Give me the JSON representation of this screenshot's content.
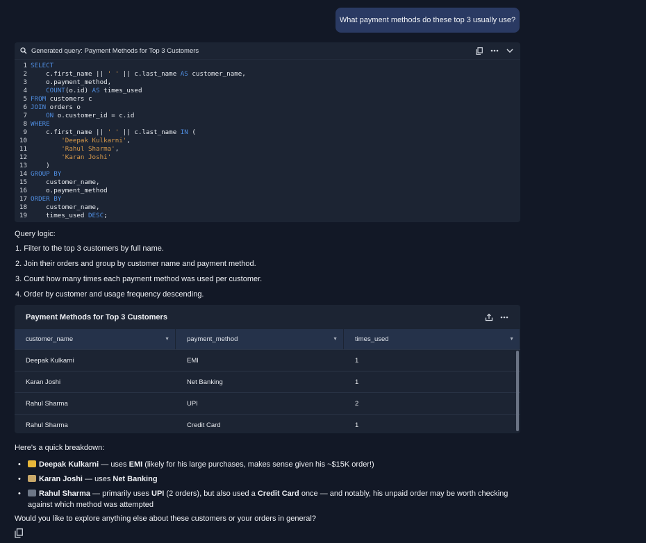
{
  "user_message": "What payment methods do these top 3 usually use?",
  "code_block": {
    "title": "Generated query: Payment Methods for Top 3 Customers",
    "lines": [
      {
        "n": "1",
        "segs": [
          [
            "kw",
            "SELECT"
          ]
        ]
      },
      {
        "n": "2",
        "segs": [
          [
            "t",
            "    c.first_name || "
          ],
          [
            "str",
            "' '"
          ],
          [
            "t",
            " || c.last_name "
          ],
          [
            "kw",
            "AS"
          ],
          [
            "t",
            " customer_name,"
          ]
        ]
      },
      {
        "n": "3",
        "segs": [
          [
            "t",
            "    o.payment_method,"
          ]
        ]
      },
      {
        "n": "4",
        "segs": [
          [
            "t",
            "    "
          ],
          [
            "kw",
            "COUNT"
          ],
          [
            "t",
            "(o.id) "
          ],
          [
            "kw",
            "AS"
          ],
          [
            "t",
            " times_used"
          ]
        ]
      },
      {
        "n": "5",
        "segs": [
          [
            "kw",
            "FROM"
          ],
          [
            "t",
            " customers c"
          ]
        ]
      },
      {
        "n": "6",
        "segs": [
          [
            "kw",
            "JOIN"
          ],
          [
            "t",
            " orders o"
          ]
        ]
      },
      {
        "n": "7",
        "segs": [
          [
            "t",
            "    "
          ],
          [
            "kw",
            "ON"
          ],
          [
            "t",
            " o.customer_id = c.id"
          ]
        ]
      },
      {
        "n": "8",
        "segs": [
          [
            "kw",
            "WHERE"
          ]
        ]
      },
      {
        "n": "9",
        "segs": [
          [
            "t",
            "    c.first_name || "
          ],
          [
            "str",
            "' '"
          ],
          [
            "t",
            " || c.last_name "
          ],
          [
            "kw",
            "IN"
          ],
          [
            "t",
            " ("
          ]
        ]
      },
      {
        "n": "10",
        "segs": [
          [
            "t",
            "        "
          ],
          [
            "str",
            "'Deepak Kulkarni'"
          ],
          [
            "t",
            ","
          ]
        ]
      },
      {
        "n": "11",
        "segs": [
          [
            "t",
            "        "
          ],
          [
            "str",
            "'Rahul Sharma'"
          ],
          [
            "t",
            ","
          ]
        ]
      },
      {
        "n": "12",
        "segs": [
          [
            "t",
            "        "
          ],
          [
            "str",
            "'Karan Joshi'"
          ]
        ]
      },
      {
        "n": "13",
        "segs": [
          [
            "t",
            "    )"
          ]
        ]
      },
      {
        "n": "14",
        "segs": [
          [
            "kw",
            "GROUP BY"
          ]
        ]
      },
      {
        "n": "15",
        "segs": [
          [
            "t",
            "    customer_name,"
          ]
        ]
      },
      {
        "n": "16",
        "segs": [
          [
            "t",
            "    o.payment_method"
          ]
        ]
      },
      {
        "n": "17",
        "segs": [
          [
            "kw",
            "ORDER BY"
          ]
        ]
      },
      {
        "n": "18",
        "segs": [
          [
            "t",
            "    customer_name,"
          ]
        ]
      },
      {
        "n": "19",
        "segs": [
          [
            "t",
            "    times_used "
          ],
          [
            "kw",
            "DESC"
          ],
          [
            "t",
            ";"
          ]
        ]
      }
    ]
  },
  "query_logic": {
    "title": "Query logic:",
    "items": [
      "1. Filter to the top 3 customers by full name.",
      "2. Join their orders and group by customer name and payment method.",
      "3. Count how many times each payment method was used per customer.",
      "4. Order by customer and usage frequency descending."
    ]
  },
  "table": {
    "title": "Payment Methods for Top 3 Customers",
    "columns": [
      "customer_name",
      "payment_method",
      "times_used"
    ],
    "rows": [
      [
        "Deepak Kulkarni",
        "EMI",
        "1"
      ],
      [
        "Karan Joshi",
        "Net Banking",
        "1"
      ],
      [
        "Rahul Sharma",
        "UPI",
        "2"
      ],
      [
        "Rahul Sharma",
        "Credit Card",
        "1"
      ]
    ]
  },
  "breakdown": {
    "title": "Here's a quick breakdown:",
    "bullets": [
      {
        "icon": "credit-card-emoji",
        "color": "#e8b73a",
        "parts": [
          [
            "b",
            "Deepak Kulkarni"
          ],
          [
            "t",
            " — uses "
          ],
          [
            "b",
            "EMI"
          ],
          [
            "t",
            " (likely for his large purchases, makes sense given his ~$15K order!)"
          ]
        ]
      },
      {
        "icon": "bank-emoji",
        "color": "#c9a96a",
        "parts": [
          [
            "b",
            "Karan Joshi"
          ],
          [
            "t",
            " — uses "
          ],
          [
            "b",
            "Net Banking"
          ]
        ]
      },
      {
        "icon": "mobile-phone-emoji",
        "color": "#6d7787",
        "parts": [
          [
            "b",
            "Rahul Sharma"
          ],
          [
            "t",
            " — primarily uses "
          ],
          [
            "b",
            "UPI"
          ],
          [
            "t",
            " (2 orders), but also used a "
          ],
          [
            "b",
            "Credit Card"
          ],
          [
            "t",
            " once — and notably, his unpaid order may be worth checking against which method was attempted"
          ]
        ]
      }
    ]
  },
  "closing": "Would you like to explore anything else about these customers or your orders in general?"
}
